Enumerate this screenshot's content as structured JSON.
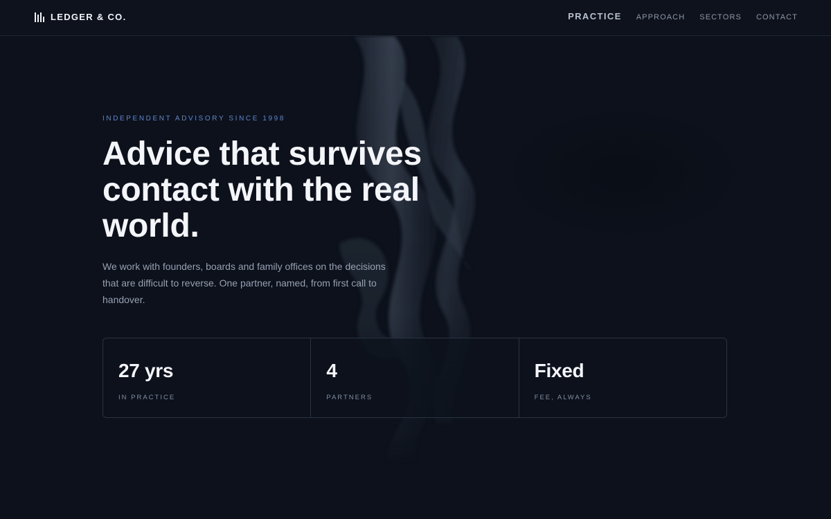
{
  "brand": {
    "name": "LEDGER & CO."
  },
  "nav": {
    "items": [
      {
        "label": "PRACTICE",
        "active": true
      },
      {
        "label": "APPROACH",
        "active": false
      },
      {
        "label": "SECTORS",
        "active": false
      },
      {
        "label": "CONTACT",
        "active": false
      }
    ]
  },
  "hero": {
    "eyebrow": "INDEPENDENT ADVISORY SINCE 1998",
    "headline_line1": "Advice that survives",
    "headline_line2": "contact with the real",
    "headline_line3": "world.",
    "lede": "We work with founders, boards and family offices on the decisions that are difficult to reverse. One partner, named, from first call to handover."
  },
  "stats": [
    {
      "value": "27 yrs",
      "label": "IN PRACTICE"
    },
    {
      "value": "4",
      "label": "PARTNERS"
    },
    {
      "value": "Fixed",
      "label": "FEE, ALWAYS"
    }
  ],
  "colors": {
    "background": "#0c111b",
    "accent": "#5f86c9",
    "text": "#f3f5f9",
    "muted": "#97a1b1",
    "border": "#2a3342"
  }
}
